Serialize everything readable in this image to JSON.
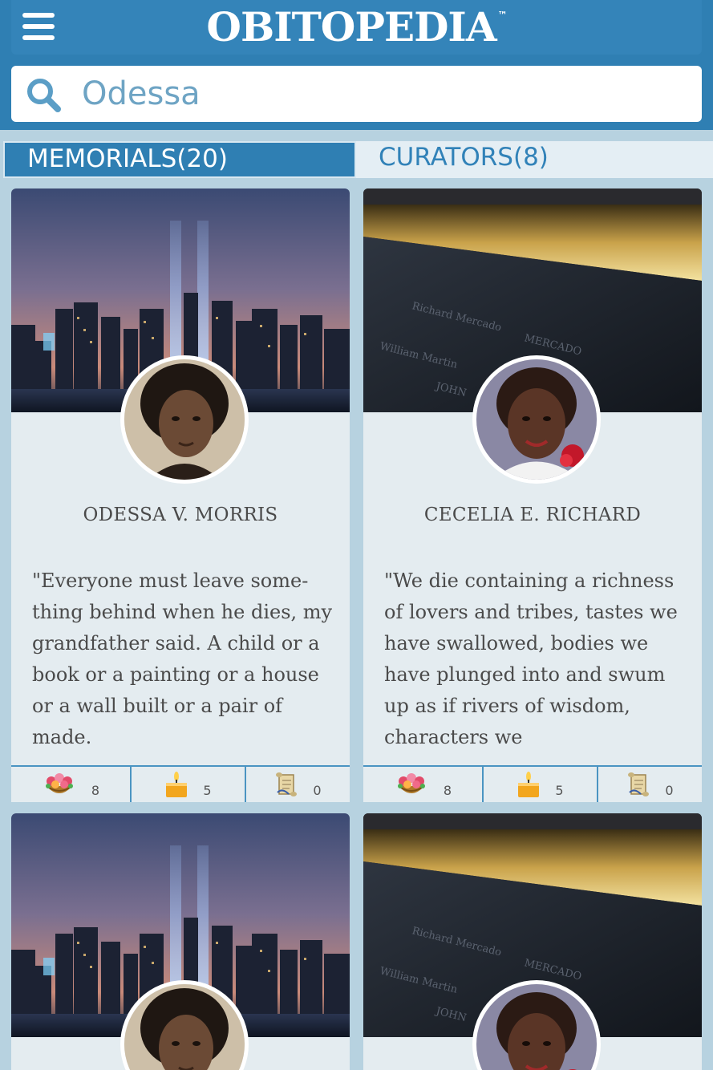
{
  "header": {
    "logo": "OBITOPEDIA",
    "trademark": "™",
    "menu_icon": "hamburger-menu-icon"
  },
  "search": {
    "value": "Odessa",
    "icon": "search-icon"
  },
  "tabs": [
    {
      "label": "MEMORIALS(20)",
      "active": true
    },
    {
      "label": "CURATORS(8)",
      "active": false
    }
  ],
  "colors": {
    "primary": "#2f7fb3",
    "background": "#b7d2e0",
    "card": "#e4ecf0",
    "text": "#4a4a4a",
    "tab_inactive_text": "#3182b8"
  },
  "memorials": [
    {
      "name": "ODESSA V. MORRIS",
      "quote": "\"Everyone must leave some-thing behind when he dies, my grandfather said. A child or a book or a painting or a house or a wall built or a pair of made.",
      "banner": "city-skyline-tribute-lights",
      "stats": {
        "flowers": "8",
        "candles": "5",
        "notes": "0"
      }
    },
    {
      "name": "CECELIA E. RICHARD",
      "quote": "\"We die containing a richness of lovers and tribes, tastes we have swallowed, bodies we have plunged into and swum up as if rivers of wisdom, characters we",
      "banner": "memorial-fountain-names",
      "stats": {
        "flowers": "8",
        "candles": "5",
        "notes": "0"
      }
    },
    {
      "banner": "city-skyline-tribute-lights"
    },
    {
      "banner": "memorial-fountain-names"
    }
  ]
}
